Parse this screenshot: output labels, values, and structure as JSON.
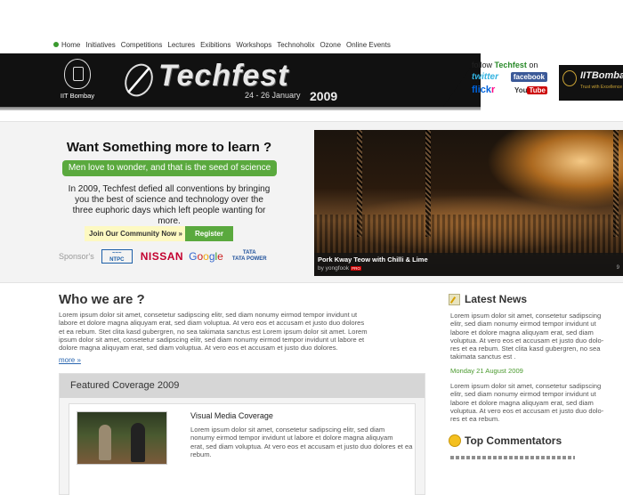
{
  "nav": {
    "items": [
      "Home",
      "Initiatives",
      "Competitions",
      "Lectures",
      "Exibitions",
      "Workshops",
      "Technoholix",
      "Ozone",
      "Online Events"
    ]
  },
  "banner": {
    "institute": "IIT Bombay",
    "title": "Techfest",
    "dates": "24 - 26 January",
    "year": "2009",
    "follow_prefix": "follow",
    "follow_brand": "Techfest",
    "follow_suffix": "on",
    "social": {
      "twitter": "twitter",
      "facebook": "facebook",
      "flickr_a": "flick",
      "flickr_b": "r",
      "youtube_a": "You",
      "youtube_b": "Tube"
    },
    "corner_title": "IITBombay",
    "corner_sub": "Trust with Excellence"
  },
  "promo": {
    "heading": "Want Something more to learn ?",
    "tagline": "Men love to wonder, and that is the seed of science",
    "body": "In 2009, Techfest defied all conventions by bringing you the best of science and technology over the three euphoric days which left people wanting for more.",
    "join_label": "Join Our Community Now »",
    "register_label": "Register",
    "sponsors_label": "Sponsor's",
    "sponsors": {
      "ntpc": "NTPC",
      "nissan": "NISSAN",
      "google": [
        "G",
        "o",
        "o",
        "g",
        "l",
        "e"
      ],
      "tata": "TATA",
      "tata_sub": "TATA POWER"
    }
  },
  "photo": {
    "caption": "Pork Kway Teow with Chilli & Lime",
    "byline": "by yongfook",
    "pro_badge": "PRO",
    "count": "9"
  },
  "who": {
    "heading": "Who we are ?",
    "body_lines": [
      "Lorem ipsum dolor sit amet, consetetur sadipscing elitr, sed diam nonumy eirmod tempor invidunt ut",
      "labore et dolore magna aliquyam erat, sed diam voluptua. At vero eos et accusam et justo duo dolores",
      "et ea rebum. Stet clita kasd gubergren, no sea takimata sanctus est Lorem ipsum dolor sit amet. Lorem",
      "ipsum dolor sit amet, consetetur sadipscing elitr,  sed diam nonumy eirmod tempor invidunt ut labore et",
      "dolore magna aliquyam erat, sed diam voluptua. At vero eos et accusam et justo duo dolores."
    ],
    "more": "more »"
  },
  "featured": {
    "heading": "Featured Coverage 2009",
    "item_title": "Visual Media Coverage",
    "item_lines": [
      "Lorem ipsum dolor sit amet, consetetur sadipscing elitr, sed diam",
      "nonumy eirmod tempor invidunt ut labore et dolore magna aliquyam",
      "erat, sed diam voluptua. At vero eos et accusam et justo duo dolores et ea",
      "rebum."
    ]
  },
  "news": {
    "heading": "Latest News",
    "item1_lines": [
      "Lorem ipsum dolor sit amet, consetetur sadipscing",
      "elitr, sed diam nonumy eirmod tempor invidunt ut",
      "labore et dolore magna aliquyam erat, sed diam",
      "voluptua. At vero eos et accusam et justo duo dolo-",
      "res et ea rebum. Stet clita kasd gubergren, no sea",
      "takimata sanctus est ."
    ],
    "date": "Monday 21 August 2009",
    "item2_lines": [
      "Lorem ipsum dolor sit amet, consetetur sadipscing",
      "elitr, sed diam nonumy eirmod tempor invidunt ut",
      "labore et dolore magna aliquyam erat, sed diam",
      "voluptua. At vero eos et accusam et justo duo dolo-",
      "res et ea rebum."
    ],
    "commentators_heading": "Top Commentators"
  }
}
